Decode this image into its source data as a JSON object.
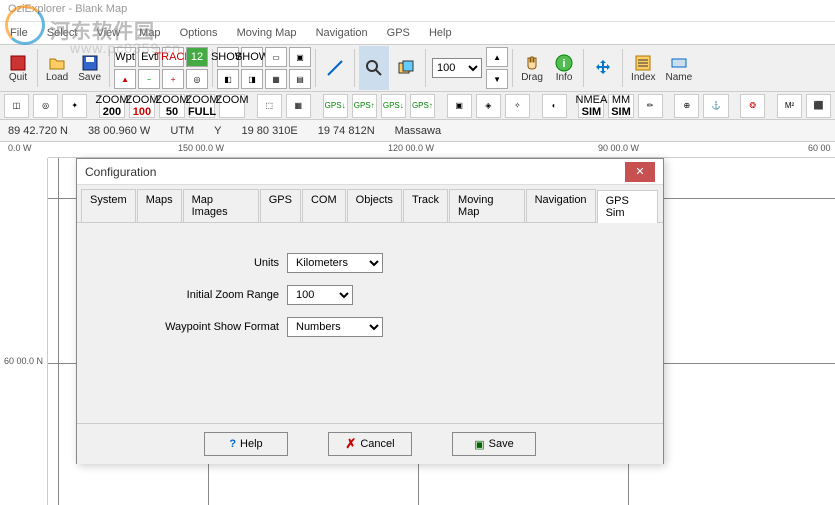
{
  "title": "OziExplorer - Blank Map",
  "watermark": {
    "text": "河东软件园",
    "url": "www.pc0359.cn"
  },
  "menu": [
    "File",
    "Select",
    "View",
    "Map",
    "Options",
    "Moving Map",
    "Navigation",
    "GPS",
    "Help"
  ],
  "toolbar1": {
    "quit": "Quit",
    "load": "Load",
    "save": "Save",
    "drag": "Drag",
    "info": "Info",
    "index": "Index",
    "name": "Name",
    "mini": {
      "wpt": "Wpt",
      "evt": "Evt",
      "trk": "TRACK",
      "n12": "12",
      "show1": "SHOW",
      "show2": "SHOW"
    },
    "zoom_value": "100"
  },
  "toolbar2": {
    "zoom200": "ZOOM",
    "z200": "200",
    "zoom100": "ZOOM",
    "z100": "100",
    "zoom50": "ZOOM",
    "z50": "50",
    "zoomfull": "ZOOM",
    "zfull": "FULL",
    "zoomb": "ZOOM",
    "nmea": "NMEA",
    "nmsim": "SIM",
    "mm": "MM",
    "msim": "SIM"
  },
  "status": {
    "lat": "89 42.720 N",
    "lon": "38 00.960 W",
    "sys": "UTM",
    "zone": "Y",
    "east": "19 80 310E",
    "north": "19 74 812N",
    "place": "Massawa"
  },
  "ruler_h": {
    "a": "0.0 W",
    "b": "150 00.0 W",
    "c": "120 00.0 W",
    "d": "90 00.0 W",
    "e": "60 00"
  },
  "ruler_v": {
    "a": "60 00.0 N"
  },
  "dialog": {
    "title": "Configuration",
    "tabs": [
      "System",
      "Maps",
      "Map Images",
      "GPS",
      "COM",
      "Objects",
      "Track",
      "Moving Map",
      "Navigation",
      "GPS Sim"
    ],
    "active_tab": "GPS Sim",
    "units_label": "Units",
    "units_value": "Kilometers",
    "zoom_label": "Initial Zoom Range",
    "zoom_value": "100",
    "wpt_label": "Waypoint Show Format",
    "wpt_value": "Numbers",
    "help": "Help",
    "cancel": "Cancel",
    "save": "Save"
  }
}
